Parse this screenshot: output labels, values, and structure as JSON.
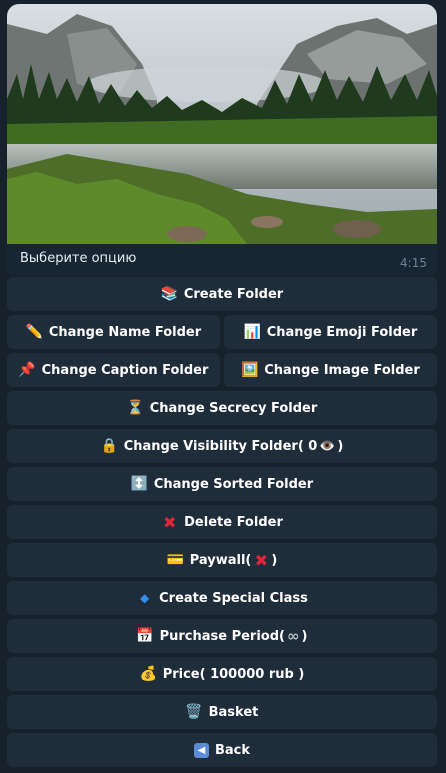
{
  "message": {
    "caption": "Выберите опцию",
    "time": "4:15",
    "image_description": "landscape-photo"
  },
  "buttons": {
    "create_folder": "Create Folder",
    "change_name_folder": "Change Name Folder",
    "change_emoji_folder": "Change Emoji Folder",
    "change_caption_folder": "Change Caption Folder",
    "change_image_folder": "Change Image Folder",
    "change_secrecy_folder": "Change Secrecy Folder",
    "change_visibility_prefix": "Change Visibility Folder( 0",
    "change_visibility_suffix": ")",
    "change_sorted_folder": "Change Sorted Folder",
    "delete_folder": "Delete Folder",
    "paywall_prefix": "Paywall(",
    "paywall_suffix": ")",
    "create_special_class": "Create Special Class",
    "purchase_period_prefix": "Purchase Period(",
    "purchase_period_value": "∞",
    "purchase_period_suffix": ")",
    "price": "Price( 100000 rub )",
    "basket": "Basket",
    "back": "Back"
  },
  "icons": {
    "create_folder": "books-icon",
    "change_name_folder": "pencil-icon",
    "change_emoji_folder": "bar-chart-icon",
    "change_caption_folder": "pushpin-icon",
    "change_image_folder": "picture-icon",
    "change_secrecy_folder": "hourglass-icon",
    "change_visibility_folder": "lock-icon",
    "visibility_eye": "eye-icon",
    "change_sorted_folder": "up-down-arrow-icon",
    "delete_folder": "cross-mark-icon",
    "paywall": "credit-card-icon",
    "paywall_state": "cross-mark-icon",
    "create_special_class": "blue-diamond-icon",
    "purchase_period": "calendar-icon",
    "price": "money-bag-icon",
    "basket": "wastebasket-icon",
    "back": "back-arrow-icon"
  },
  "colors": {
    "background": "#17212b",
    "button": "#1f2c3a",
    "message_bubble": "#182533",
    "text": "#ffffff",
    "time": "#6d8196",
    "cross": "#e0243a"
  }
}
